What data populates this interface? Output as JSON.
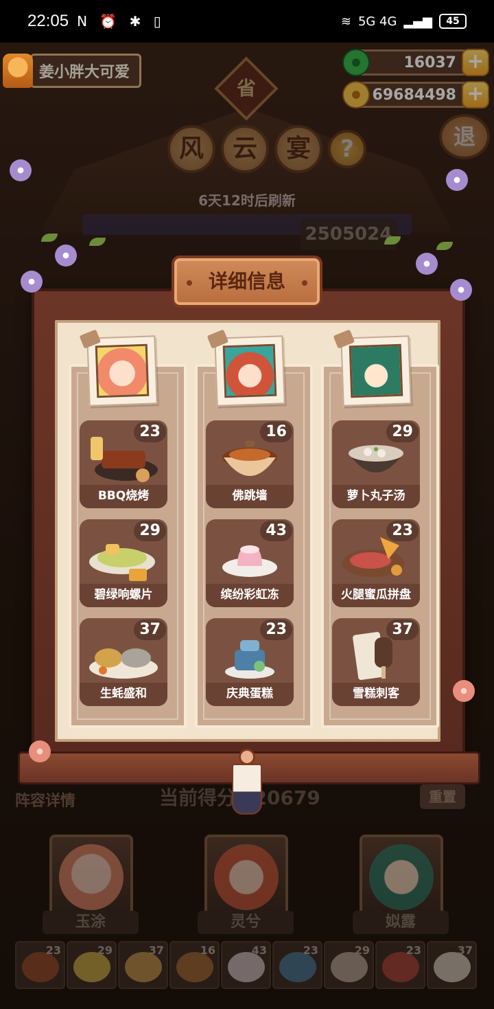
{
  "status_bar": {
    "time": "22:05",
    "left_icons": "N ⏰ ✱ ▯",
    "network": "5G  4G",
    "battery": "45"
  },
  "user": {
    "name": "姜小胖大可爱"
  },
  "currencies": {
    "jade": "16037",
    "gold": "69684498"
  },
  "header": {
    "province": "省",
    "title_chars": [
      "风",
      "云",
      "宴"
    ],
    "help": "?",
    "exit": "退",
    "refresh_text": "6天12时后刷新",
    "score_partial": "2505024"
  },
  "modal": {
    "title": "详细信息",
    "columns": [
      {
        "character": "玉涂",
        "dishes": [
          {
            "name": "BBQ烧烤",
            "count": "23"
          },
          {
            "name": "碧绿响螺片",
            "count": "29"
          },
          {
            "name": "生蚝盛和",
            "count": "37"
          }
        ]
      },
      {
        "character": "灵兮",
        "dishes": [
          {
            "name": "佛跳墙",
            "count": "16"
          },
          {
            "name": "缤纷彩虹冻",
            "count": "43"
          },
          {
            "name": "庆典蛋糕",
            "count": "23"
          }
        ]
      },
      {
        "character": "姒露",
        "dishes": [
          {
            "name": "萝卜丸子汤",
            "count": "29"
          },
          {
            "name": "火腿蜜瓜拼盘",
            "count": "23"
          },
          {
            "name": "雪糕刺客",
            "count": "37"
          }
        ]
      }
    ]
  },
  "background": {
    "lineup_label": "阵容详情",
    "current_score_label": "当前得分",
    "current_score_value": "520679",
    "rebuild_label": "重置",
    "characters": [
      "玉涂",
      "灵兮",
      "姒露"
    ],
    "tray_counts": [
      "23",
      "29",
      "37",
      "16",
      "43",
      "23",
      "29",
      "23",
      "37"
    ]
  },
  "colors": {
    "panel_frame": "#6b3527",
    "panel_inner": "#f2e3cd",
    "dish_card": "#7b5241",
    "title_plaque": "#c97c4a"
  }
}
